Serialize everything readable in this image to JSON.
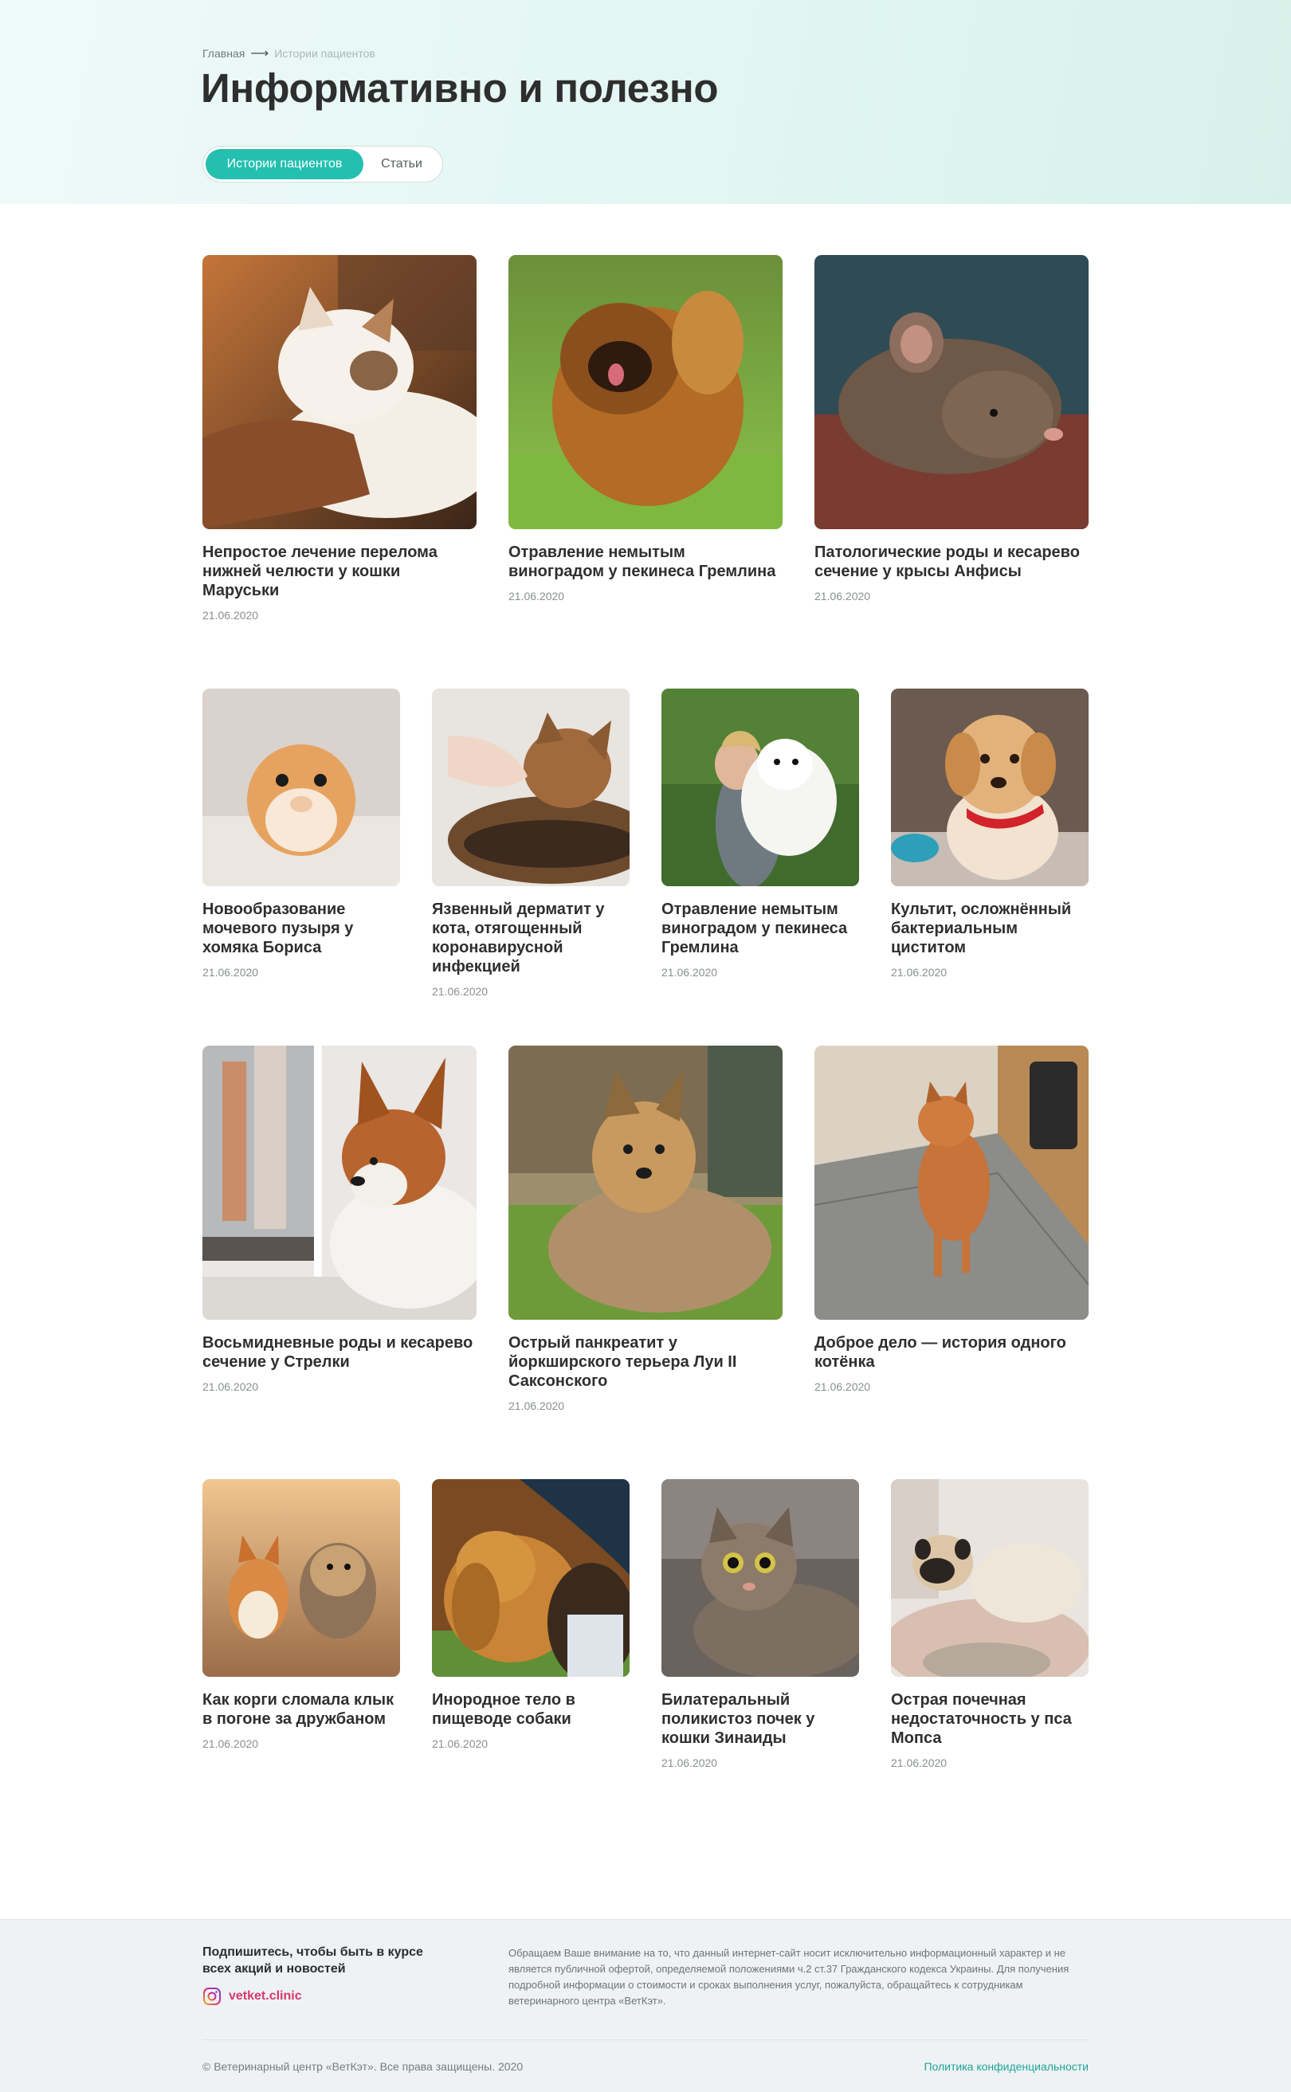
{
  "breadcrumb": {
    "home": "Главная",
    "current": "Истории пациентов"
  },
  "page_title": "Информативно и полезно",
  "tabs": [
    {
      "label": "Истории пациентов",
      "active": true
    },
    {
      "label": "Статьи",
      "active": false
    }
  ],
  "accent_color": "#23c0b0",
  "cards": [
    {
      "title": "Непростое лечение перелома нижней челюсти у кошки Маруськи",
      "date": "21.06.2020",
      "image": "cat-being-petted"
    },
    {
      "title": "Отравление немытым виноградом у пекинеса Гремлина",
      "date": "21.06.2020",
      "image": "pekingese-on-grass"
    },
    {
      "title": "Патологические роды и кесарево сечение у крысы Анфисы",
      "date": "21.06.2020",
      "image": "rat"
    },
    {
      "title": "Новообразование мочевого пузыря у хомяка Бориса",
      "date": "21.06.2020",
      "image": "hamster"
    },
    {
      "title": "Язвенный дерматит у кота, отягощенный коронавирусной инфекцией",
      "date": "21.06.2020",
      "image": "tabby-cat-petted"
    },
    {
      "title": "Отравление немытым виноградом у пекинеса Гремлина",
      "date": "21.06.2020",
      "image": "woman-with-samoyed"
    },
    {
      "title": "Культит, осложнённый бактериальным циститом",
      "date": "21.06.2020",
      "image": "golden-puppy"
    },
    {
      "title": "Восьмидневные роды и кесарево сечение у Стрелки",
      "date": "21.06.2020",
      "image": "corgi-at-window"
    },
    {
      "title": "Острый панкреатит у йоркширского терьера Луи II Саксонского",
      "date": "21.06.2020",
      "image": "yorkshire-terrier"
    },
    {
      "title": "Доброе дело — история одного котёнка",
      "date": "21.06.2020",
      "image": "ginger-cat-walking"
    },
    {
      "title": "Как корги сломала клык в погоне за дружбаном",
      "date": "21.06.2020",
      "image": "corgi-and-terrier-running"
    },
    {
      "title": "Инородное тело в пищеводе собаки",
      "date": "21.06.2020",
      "image": "golden-retriever"
    },
    {
      "title": "Билатеральный поликистоз почек у кошки Зинаиды",
      "date": "21.06.2020",
      "image": "surprised-tabby-cat"
    },
    {
      "title": "Острая почечная недостаточность у пса Мопса",
      "date": "21.06.2020",
      "image": "pug-on-bed"
    }
  ],
  "footer": {
    "subscribe": "Подпишитесь, чтобы быть в курсе всех акций и новостей",
    "instagram_handle": "vetket.clinic",
    "disclaimer": "Обращаем Ваше внимание на то, что данный интернет-сайт носит исключительно информационный характер и не является публичной офертой, определяемой положениями ч.2 ст.37 Гражданского кодекса Украины. Для получения подробной информации о стоимости и сроках выполнения услуг, пожалуйста, обращайтесь к сотрудникам ветеринарного центра «ВетКэт».",
    "copyright": "© Ветеринарный центр «ВетКэт». Все права защищены. 2020",
    "privacy_link": "Политика конфиденциальности"
  }
}
